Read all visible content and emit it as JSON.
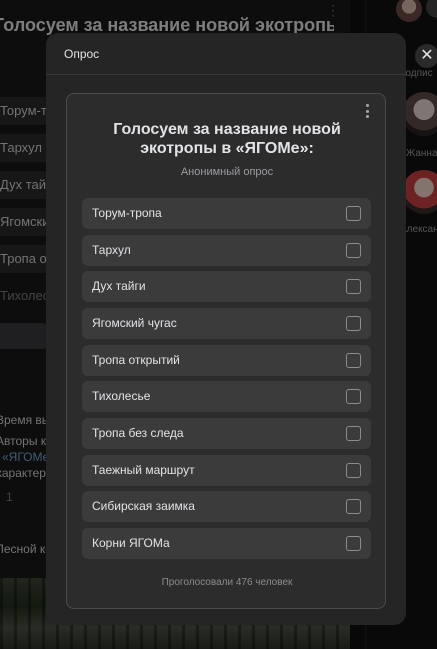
{
  "background": {
    "post_title": "Голосуем за название новой экотропы в",
    "options": [
      "Торум-тропа",
      "Тархул",
      "Дух тайги",
      "Ягомский чугас",
      "Тропа открытий",
      "Тихолесье"
    ],
    "text_lines": [
      "Время выбо",
      "Авторы конк",
      "«ЯГОМе»",
      "характер",
      "1",
      "Лесной ком"
    ],
    "right_labels": [
      "подпис",
      "Жанна",
      "Александ"
    ]
  },
  "modal": {
    "header_title": "Опрос",
    "close_label": "✕",
    "poll": {
      "title": "Голосуем за название новой экотропы в «ЯГОМе»:",
      "subtitle": "Анонимный опрос",
      "options": [
        "Торум-тропа",
        "Тархул",
        "Дух тайги",
        "Ягомский чугас",
        "Тропа открытий",
        "Тихолесье",
        "Тропа без следа",
        "Таежный маршрут",
        "Сибирская заимка",
        "Корни ЯГОМа"
      ],
      "footer": "Проголосовали 476 человек"
    }
  },
  "colors": {
    "modal_bg": "#252526",
    "card_bg": "#2c2c2d",
    "option_bg": "#3b3b3c",
    "text": "#e1e3e6",
    "muted": "#9a9ca0"
  }
}
